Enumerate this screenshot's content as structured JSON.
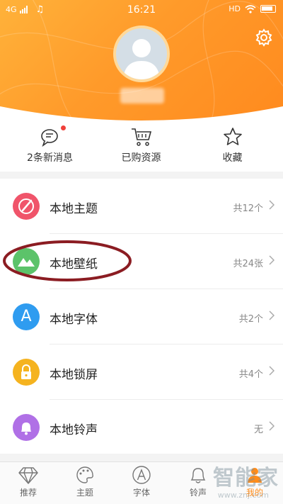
{
  "status_bar": {
    "network": "4G",
    "time": "16:21",
    "hd_label": "HD",
    "icons": [
      "signal-icon",
      "music-icon",
      "wifi-icon",
      "battery-icon"
    ]
  },
  "profile": {
    "avatar_icon": "avatar-placeholder",
    "settings_icon": "gear-icon"
  },
  "quick_actions": [
    {
      "label": "2条新消息",
      "icon": "message-icon",
      "has_badge": true
    },
    {
      "label": "已购资源",
      "icon": "cart-icon",
      "has_badge": false
    },
    {
      "label": "收藏",
      "icon": "star-icon",
      "has_badge": false
    }
  ],
  "list": [
    {
      "title": "本地主题",
      "count": "共12个",
      "icon": "palette-icon",
      "color": "#f0546a"
    },
    {
      "title": "本地壁纸",
      "count": "共24张",
      "icon": "mountain-icon",
      "color": "#5cc36a"
    },
    {
      "title": "本地字体",
      "count": "共2个",
      "icon": "font-a-icon",
      "color": "#2f9cf0",
      "icon_text": "A"
    },
    {
      "title": "本地锁屏",
      "count": "共4个",
      "icon": "lock-icon",
      "color": "#f5b31f"
    },
    {
      "title": "本地铃声",
      "count": "无",
      "icon": "bell-icon",
      "color": "#b070e6"
    }
  ],
  "tabs": [
    {
      "label": "推荐",
      "icon": "diamond-icon",
      "active": false
    },
    {
      "label": "主题",
      "icon": "palette-icon",
      "active": false
    },
    {
      "label": "字体",
      "icon": "font-a-icon",
      "active": false,
      "icon_text": "A"
    },
    {
      "label": "铃声",
      "icon": "bell-icon",
      "active": false
    },
    {
      "label": "我的",
      "icon": "person-icon",
      "active": true
    }
  ],
  "watermark": {
    "text": "智能家",
    "url": "www.znj.com"
  },
  "colors": {
    "header": "#ff9a2a",
    "accent": "#ff8c1a",
    "highlight_oval": "#8b1c22"
  }
}
